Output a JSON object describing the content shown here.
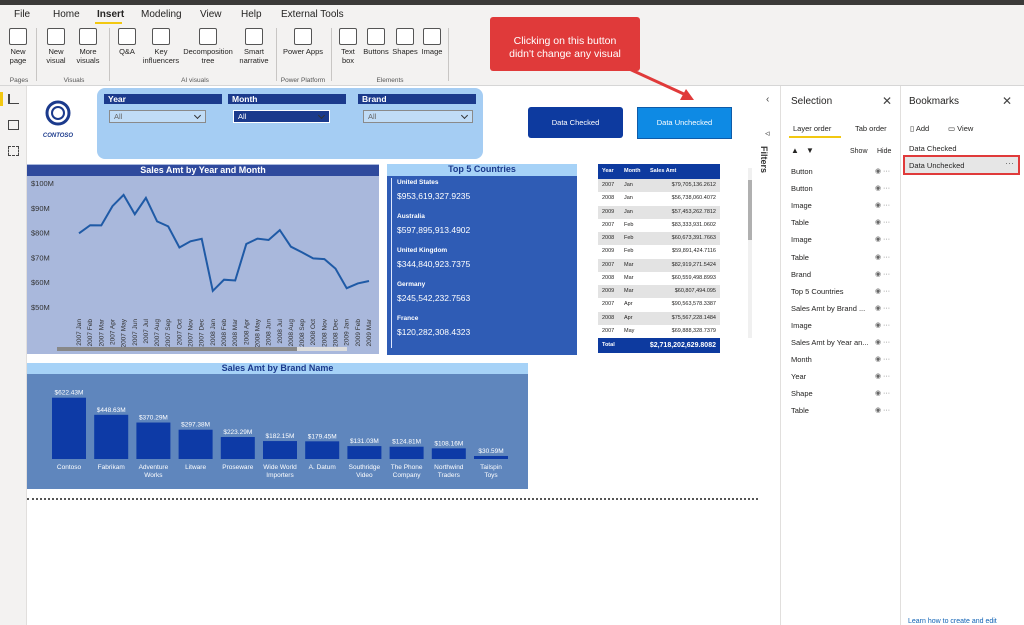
{
  "tabs": [
    "File",
    "Home",
    "Insert",
    "Modeling",
    "View",
    "Help",
    "External Tools"
  ],
  "ribbon": {
    "new_page": "New\npage",
    "new_visual": "New\nvisual",
    "more_visuals": "More\nvisuals",
    "qa": "Q&A",
    "key_influencers": "Key\ninfluencers",
    "decomp": "Decomposition\ntree",
    "smart": "Smart\nnarrative",
    "power_apps": "Power Apps",
    "text_box": "Text\nbox",
    "buttons": "Buttons",
    "shapes": "Shapes",
    "image": "Image",
    "grp_pages": "Pages",
    "grp_visuals": "Visuals",
    "grp_ai": "AI visuals",
    "grp_pp": "Power Platform",
    "grp_elements": "Elements"
  },
  "callout": "Clicking on this button didn't change any visual",
  "slicers": [
    {
      "title": "Year",
      "value": "All"
    },
    {
      "title": "Month",
      "value": "All"
    },
    {
      "title": "Brand",
      "value": "All"
    }
  ],
  "logo": "CONTOSO",
  "buttons": {
    "checked": "Data Checked",
    "unchecked": "Data Unchecked"
  },
  "chart_data": [
    {
      "type": "line",
      "title": "Sales Amt by Year and Month",
      "x": [
        "2007 Jan",
        "2007 Feb",
        "2007 Mar",
        "2007 Apr",
        "2007 May",
        "2007 Jun",
        "2007 Jul",
        "2007 Aug",
        "2007 Sep",
        "2007 Oct",
        "2007 Nov",
        "2007 Dec",
        "2008 Jan",
        "2008 Feb",
        "2008 Mar",
        "2008 Apr",
        "2008 May",
        "2008 Jun",
        "2008 Jul",
        "2008 Aug",
        "2008 Sep",
        "2008 Oct",
        "2008 Nov",
        "2008 Dec",
        "2009 Jan",
        "2009 Feb",
        "2009 Mar"
      ],
      "values": [
        79.7,
        83.0,
        82.9,
        90.7,
        95.2,
        87.4,
        94.0,
        84.5,
        82.5,
        74.0,
        76.5,
        77.5,
        56.5,
        61.0,
        60.7,
        75.4,
        77.6,
        77.0,
        81.0,
        74.3,
        72.0,
        69.6,
        69.3,
        65.5,
        57.6,
        59.5,
        60.5
      ],
      "yticks": [
        "$100M",
        "$90M",
        "$80M",
        "$70M",
        "$60M",
        "$50M"
      ],
      "ylim": [
        50,
        100
      ]
    },
    {
      "type": "bar",
      "title": "Sales Amt by Brand Name",
      "categories": [
        "Contoso",
        "Fabrikam",
        "Adventure Works",
        "Litware",
        "Proseware",
        "Wide World Importers",
        "A. Datum",
        "Southridge Video",
        "The Phone Company",
        "Northwind Traders",
        "Tailspin Toys"
      ],
      "values": [
        622.43,
        448.63,
        370.29,
        297.38,
        223.29,
        182.15,
        179.45,
        131.03,
        124.81,
        108.16,
        30.59
      ],
      "labels": [
        "$622.43M",
        "$448.63M",
        "$370.29M",
        "$297.38M",
        "$223.29M",
        "$182.15M",
        "$179.45M",
        "$131.03M",
        "$124.81M",
        "$108.16M",
        "$30.59M"
      ]
    }
  ],
  "top5": {
    "title": "Top 5 Countries",
    "items": [
      {
        "name": "United States",
        "value": "$953,619,327.9235"
      },
      {
        "name": "Australia",
        "value": "$597,895,913.4902"
      },
      {
        "name": "United Kingdom",
        "value": "$344,840,923.7375"
      },
      {
        "name": "Germany",
        "value": "$245,542,232.7563"
      },
      {
        "name": "France",
        "value": "$120,282,308.4323"
      }
    ]
  },
  "table": {
    "headers": [
      "Year",
      "Month",
      "Sales Amt"
    ],
    "rows": [
      [
        "2007",
        "Jan",
        "$79,705,136.2612"
      ],
      [
        "2008",
        "Jan",
        "$56,738,060.4072"
      ],
      [
        "2009",
        "Jan",
        "$57,453,262.7812"
      ],
      [
        "2007",
        "Feb",
        "$83,333,931.0602"
      ],
      [
        "2008",
        "Feb",
        "$60,673,391.7663"
      ],
      [
        "2009",
        "Feb",
        "$59,891,424.7116"
      ],
      [
        "2007",
        "Mar",
        "$82,919,271.5424"
      ],
      [
        "2008",
        "Mar",
        "$60,559,498.8993"
      ],
      [
        "2009",
        "Mar",
        "$60,807,494.095"
      ],
      [
        "2007",
        "Apr",
        "$90,563,578.3387"
      ],
      [
        "2008",
        "Apr",
        "$75,567,228.1484"
      ],
      [
        "2007",
        "May",
        "$69,888,328.7379"
      ]
    ],
    "total_label": "Total",
    "total": "$2,718,202,629.8082"
  },
  "filters": "Filters",
  "selection": {
    "title": "Selection",
    "tab_layer": "Layer order",
    "tab_tab": "Tab order",
    "show": "Show",
    "hide": "Hide",
    "items": [
      "Button",
      "Button",
      "Image",
      "Table",
      "Image",
      "Table",
      "Brand",
      "Top 5 Countries",
      "Sales Amt by Brand ...",
      "Image",
      "Sales Amt by Year an...",
      "Month",
      "Year",
      "Shape",
      "Table"
    ]
  },
  "bookmarks": {
    "title": "Bookmarks",
    "add": "Add",
    "view": "View",
    "items": [
      "Data Checked",
      "Data Unchecked"
    ],
    "footer": "Learn how to create and edit"
  }
}
